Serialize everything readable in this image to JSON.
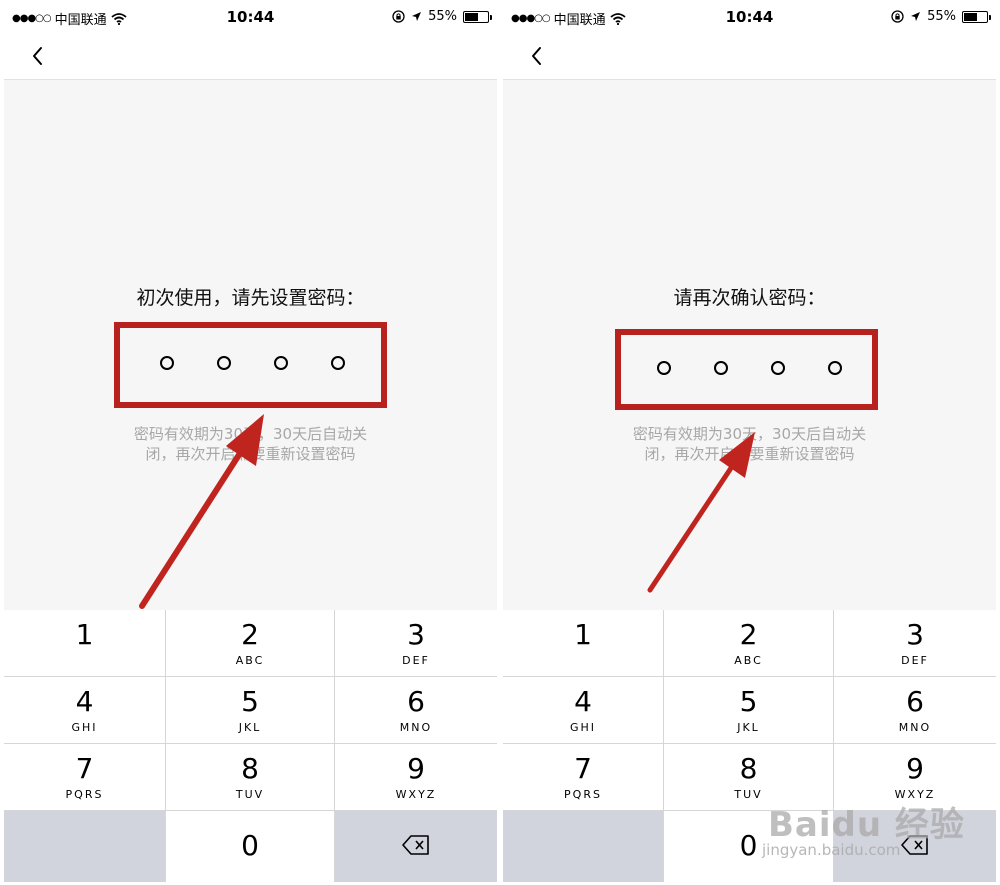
{
  "status_bar": {
    "carrier": "中国联通",
    "time": "10:44",
    "battery_percent": "55%",
    "battery_level": 0.55,
    "signal_dots": "●●●○○"
  },
  "screens": [
    {
      "prompt": "初次使用，请先设置密码：",
      "hint_line1": "密码有效期为30天，30天后自动关",
      "hint_line2": "闭，再次开启需要重新设置密码"
    },
    {
      "prompt": "请再次确认密码：",
      "hint_line1": "密码有效期为30天，30天后自动关",
      "hint_line2": "闭，再次开启需要重新设置密码"
    }
  ],
  "keypad": [
    {
      "num": "1",
      "letters": ""
    },
    {
      "num": "2",
      "letters": "ABC"
    },
    {
      "num": "3",
      "letters": "DEF"
    },
    {
      "num": "4",
      "letters": "GHI"
    },
    {
      "num": "5",
      "letters": "JKL"
    },
    {
      "num": "6",
      "letters": "MNO"
    },
    {
      "num": "7",
      "letters": "PQRS"
    },
    {
      "num": "8",
      "letters": "TUV"
    },
    {
      "num": "9",
      "letters": "WXYZ"
    },
    {
      "num": "0",
      "letters": ""
    }
  ],
  "watermark": {
    "brand": "Baidu 经验",
    "url": "jingyan.baidu.com"
  },
  "colors": {
    "highlight": "#b7221e",
    "content_bg": "#f6f6f6",
    "key_gray": "#d1d4dd",
    "hint_text": "#a7a7a7"
  },
  "icons": [
    "back-chevron-icon",
    "wifi-icon",
    "lock-rotation-icon",
    "location-arrow-icon",
    "battery-icon",
    "backspace-icon"
  ]
}
